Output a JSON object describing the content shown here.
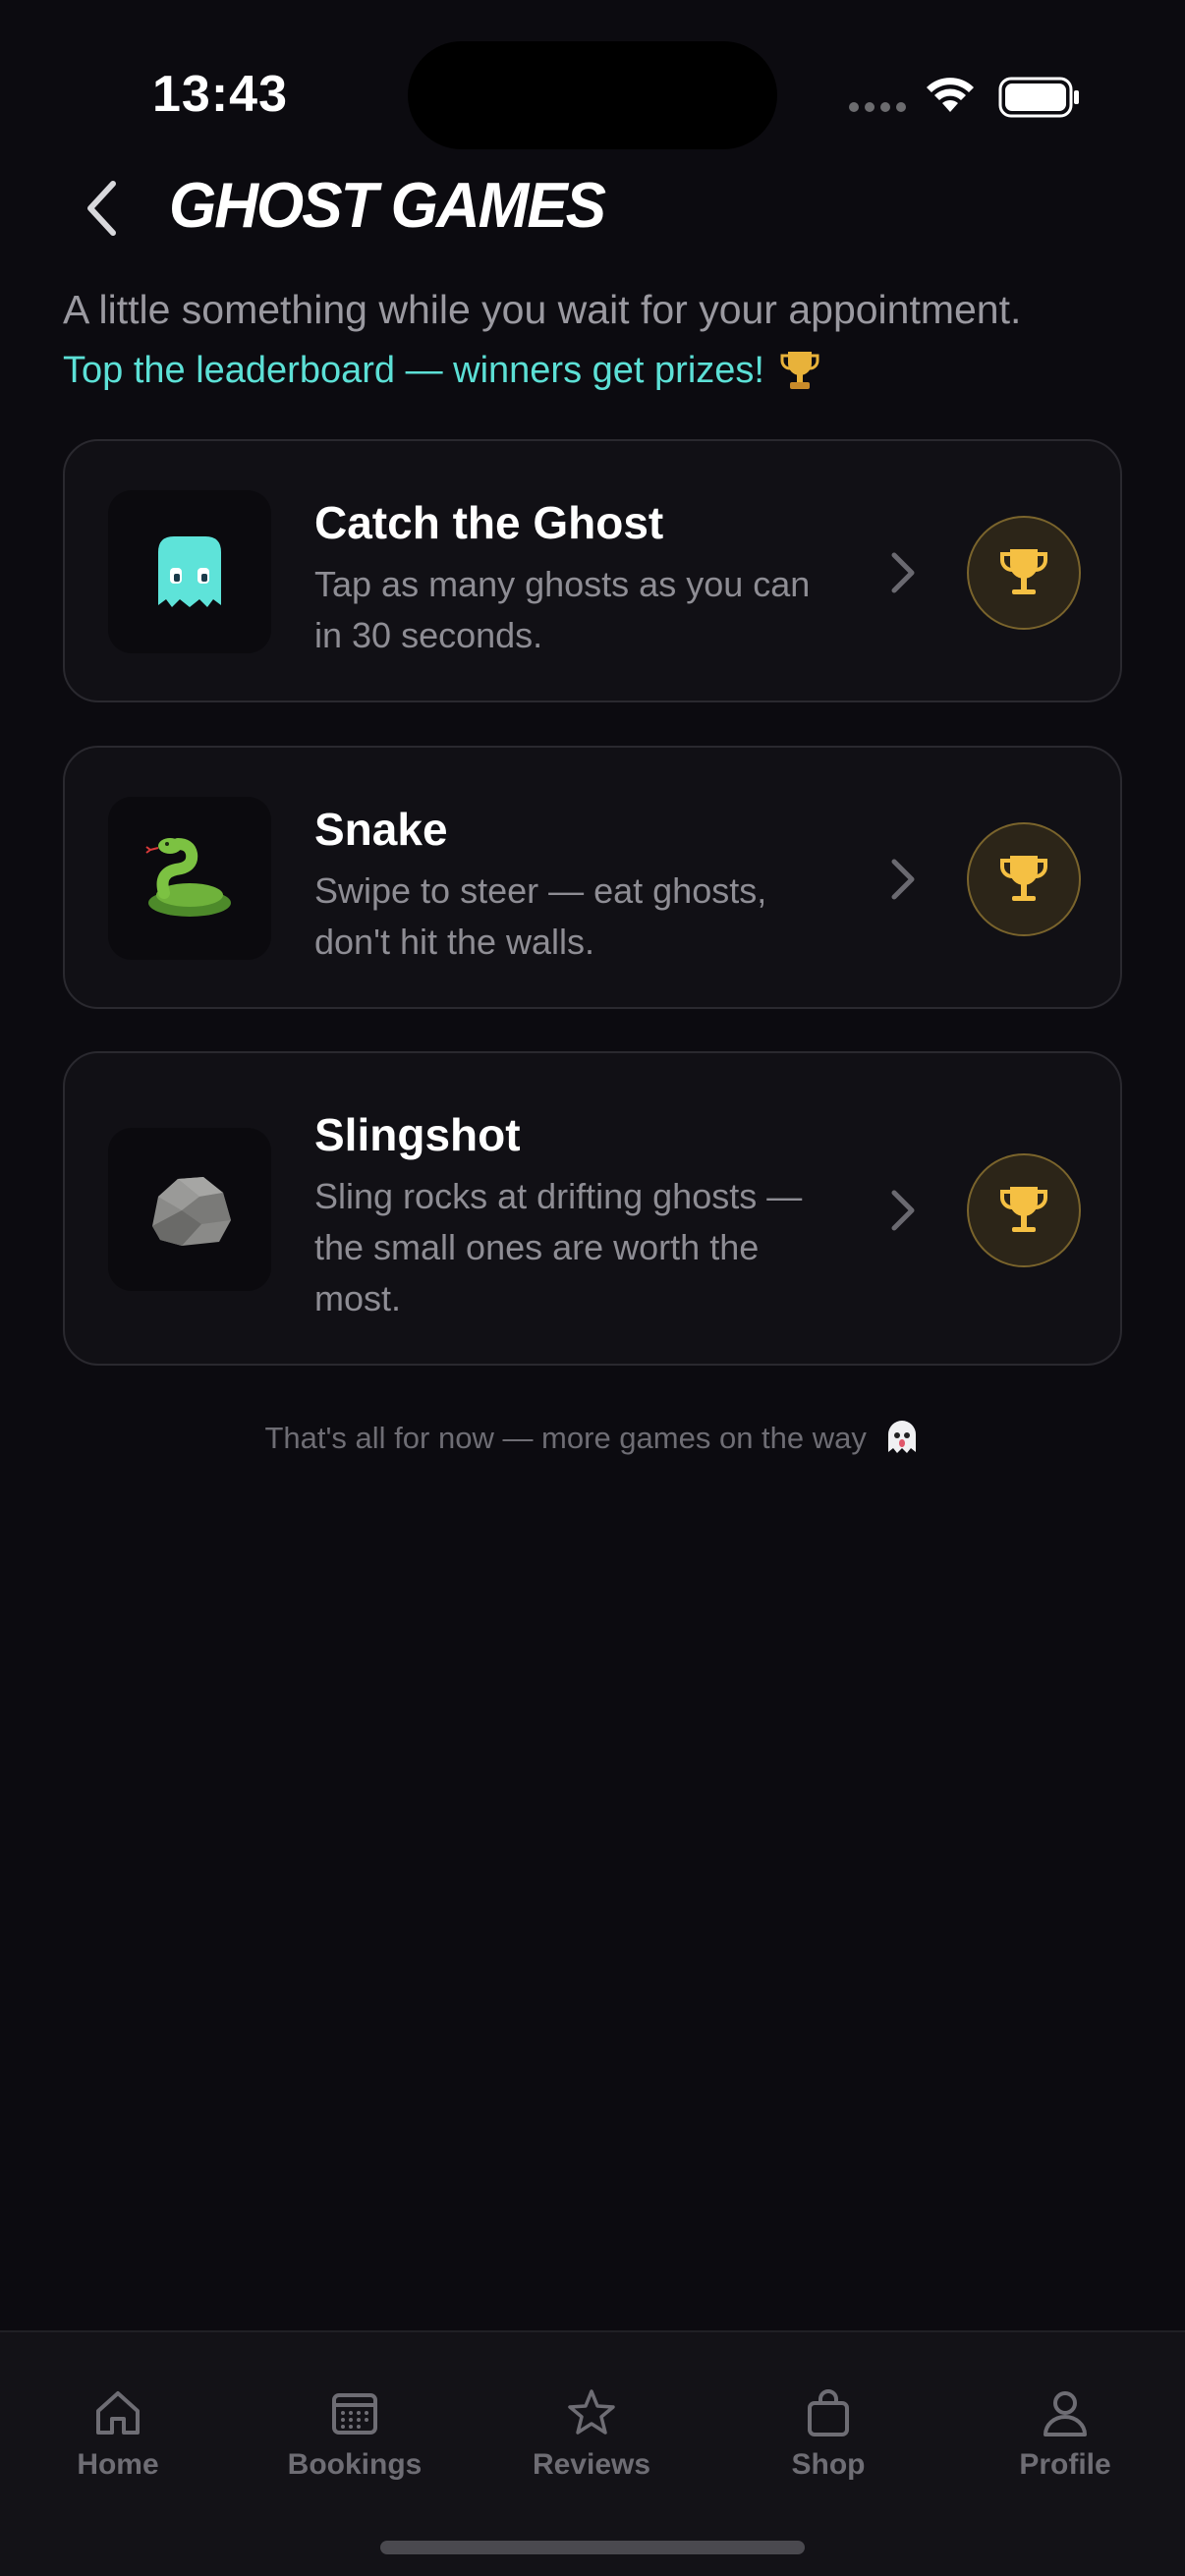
{
  "status_bar": {
    "time": "13:43"
  },
  "header": {
    "title": "GHOST GAMES",
    "subtitle": "A little something while you wait for your appointment.",
    "promo": "Top the leaderboard — winners get prizes!",
    "promo_icon": "trophy-icon"
  },
  "games": [
    {
      "title": "Catch the Ghost",
      "description": "Tap as many ghosts as you can in 30 seconds.",
      "icon": "ghost-icon"
    },
    {
      "title": "Snake",
      "description": "Swipe to steer — eat ghosts, don't hit the walls.",
      "icon": "snake-icon"
    },
    {
      "title": "Slingshot",
      "description": "Sling rocks at drifting ghosts — the small ones are worth the most.",
      "icon": "rock-icon"
    }
  ],
  "footer_note": "That's all for now — more games on the way",
  "tabbar": {
    "items": [
      {
        "label": "Home",
        "icon": "home-icon"
      },
      {
        "label": "Bookings",
        "icon": "calendar-icon"
      },
      {
        "label": "Reviews",
        "icon": "star-icon"
      },
      {
        "label": "Shop",
        "icon": "bag-icon"
      },
      {
        "label": "Profile",
        "icon": "person-icon"
      }
    ]
  },
  "colors": {
    "background": "#0c0b10",
    "accent": "#5ce0d6",
    "trophy": "#f5c043",
    "muted_text": "#8e8d94"
  }
}
